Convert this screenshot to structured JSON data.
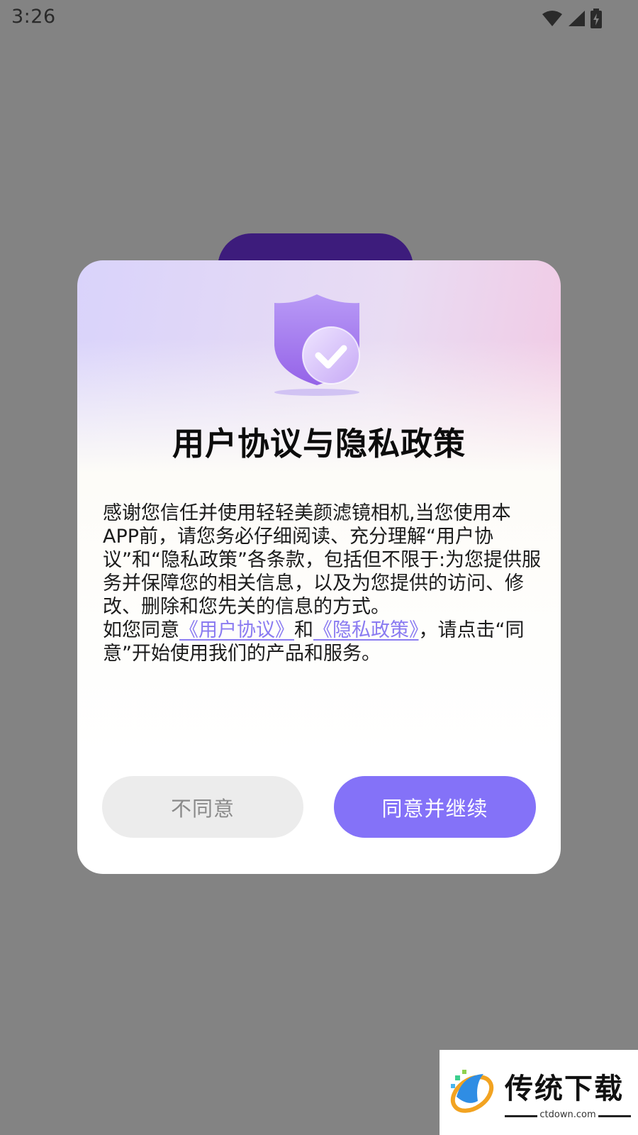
{
  "status_bar": {
    "time": "3:26",
    "icons": [
      "wifi-icon",
      "cell-signal-icon",
      "battery-charging-icon"
    ]
  },
  "dialog": {
    "title": "用户协议与隐私政策",
    "body_paragraph": "感谢您信任并使用轻轻美颜滤镜相机,当您使用本APP前，请您务必仔细阅读、充分理解“用户协议”和“隐私政策”各条款，包括但不限于:为您提供服务并保障您的相关信息，以及为您提供的访问、修改、删除和您先关的信息的方式。",
    "consent_prefix": "如您同意",
    "user_agreement_link": "《用户协议》",
    "connector": "和",
    "privacy_policy_link": "《隐私政策》",
    "consent_suffix": "，请点击“同意”开始使用我们的产品和服务。",
    "disagree_label": "不同意",
    "agree_label": "同意并继续"
  },
  "watermark": {
    "brand": "传统下载",
    "url": "ctdown.com"
  },
  "colors": {
    "overlay": "#838383",
    "accent": "#8472f8",
    "link": "#8a7bf1",
    "background_tab": "#3d1c7c"
  }
}
